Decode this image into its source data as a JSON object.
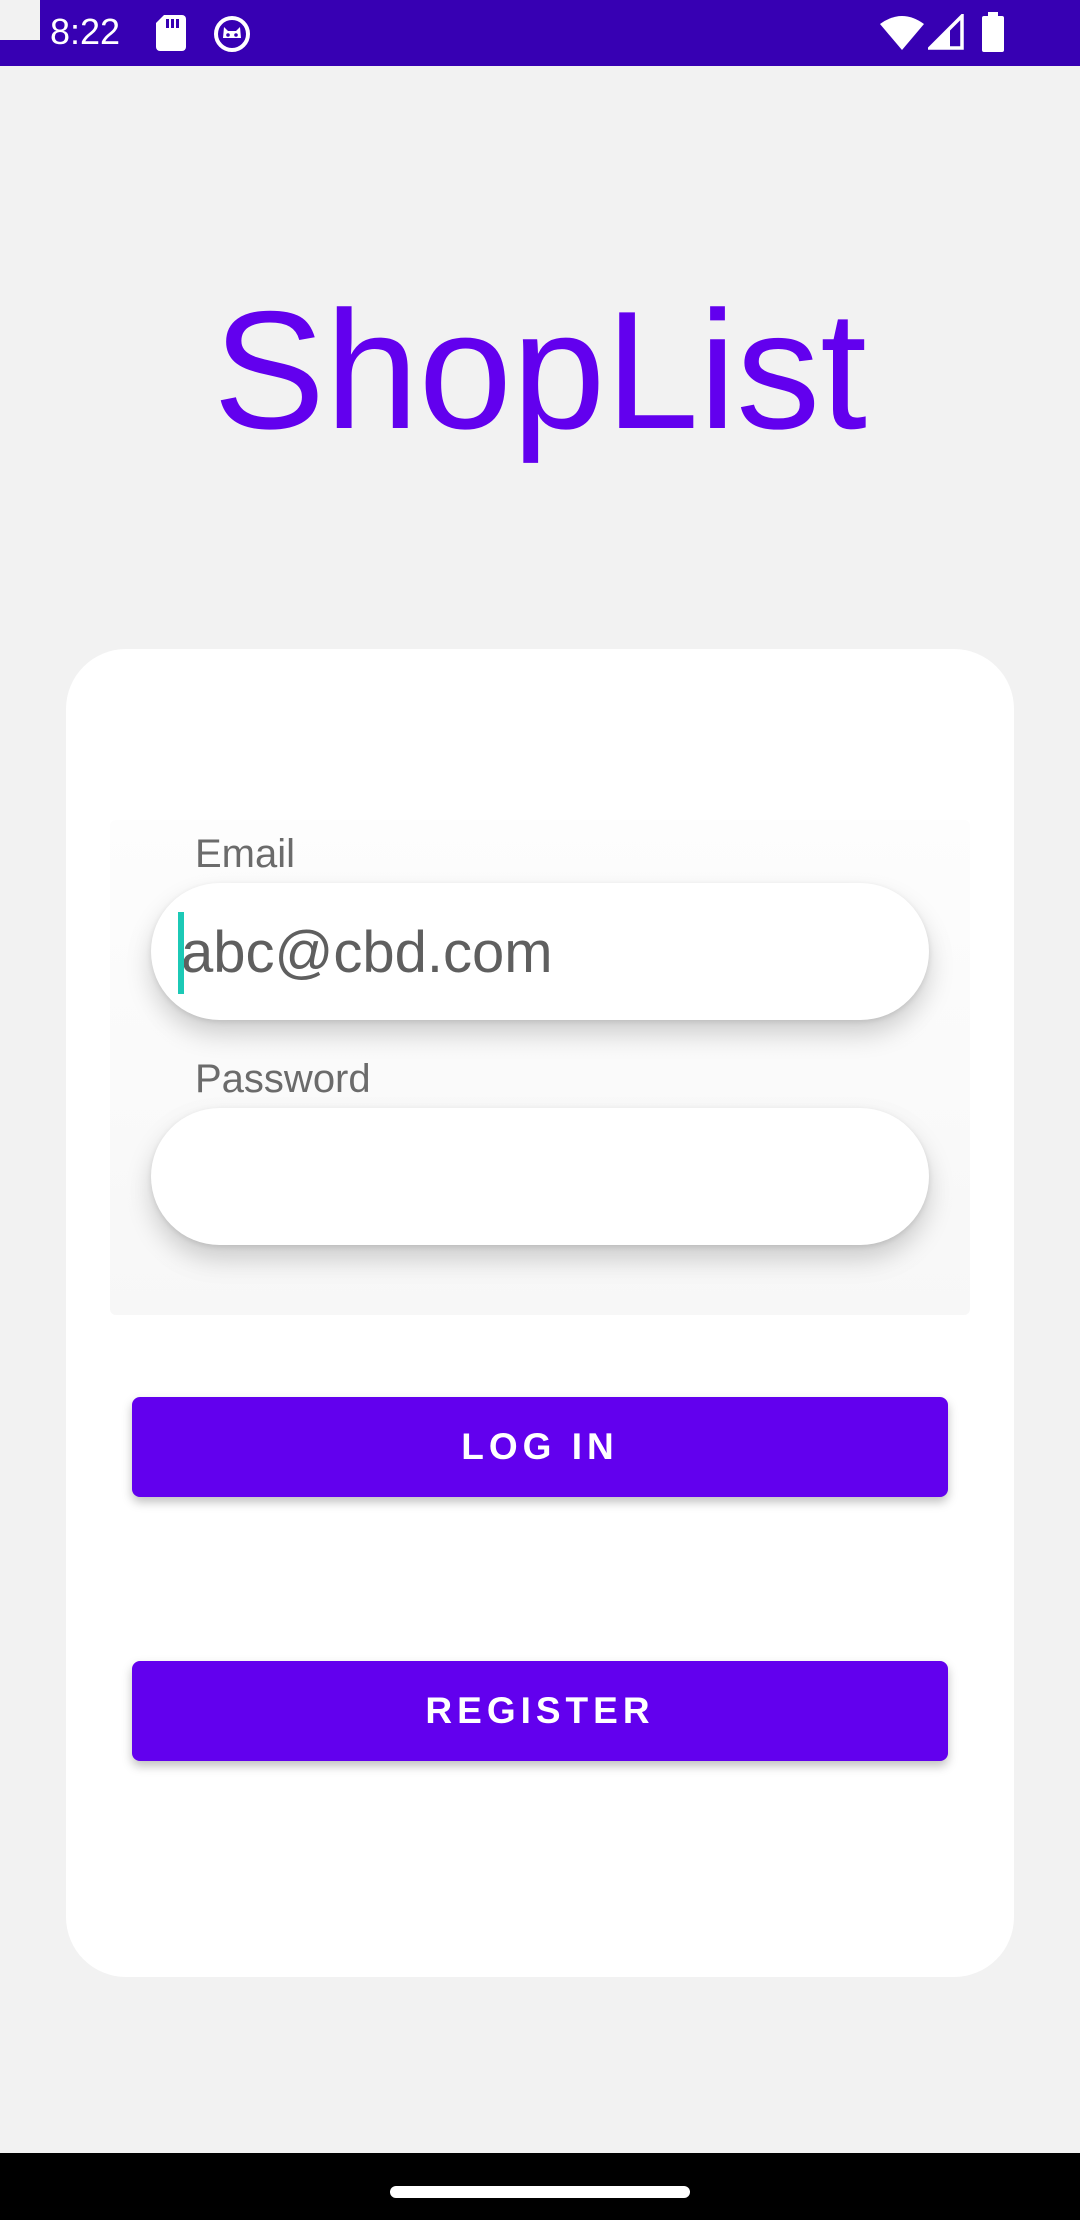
{
  "status_bar": {
    "time": "8:22",
    "icons": [
      "sd-card-icon",
      "cat-icon",
      "wifi-icon",
      "signal-icon",
      "battery-icon"
    ]
  },
  "app": {
    "title": "ShopList"
  },
  "form": {
    "email_label": "Email",
    "email_value": "abc@cbd.com",
    "password_label": "Password",
    "password_value": ""
  },
  "buttons": {
    "login_label": "LOG IN",
    "register_label": "REGISTER"
  },
  "colors": {
    "primary": "#6200ee",
    "status_bar": "#3700b3",
    "background": "#f2f2f2",
    "cursor": "#1cc9b6"
  }
}
